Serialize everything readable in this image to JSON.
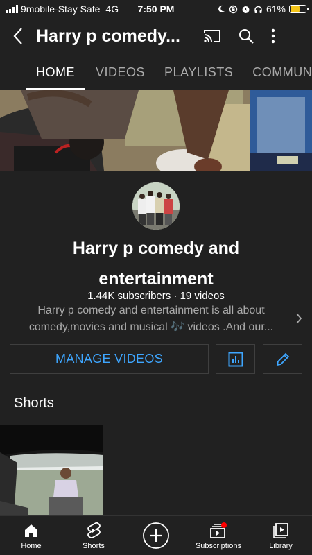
{
  "status_bar": {
    "carrier": "9mobile-Stay Safe",
    "network": "4G",
    "time": "7:50 PM",
    "battery": "61%",
    "battery_level": 0.61,
    "icons": [
      "moon-icon",
      "orientation-lock-icon",
      "alarm-icon",
      "headphones-icon"
    ]
  },
  "header": {
    "title": "Harry p comedy...",
    "icons": [
      "back-arrow-icon",
      "cast-icon",
      "search-icon",
      "more-vert-icon"
    ]
  },
  "tabs": [
    "HOME",
    "VIDEOS",
    "PLAYLISTS",
    "COMMUN"
  ],
  "channel": {
    "name": "Harry p comedy and entertainment",
    "stats": "1.44K subscribers · 19 videos",
    "description": "Harry p comedy and entertainment is all about comedy,movies and musical 🎶 videos .And our..."
  },
  "actions": {
    "manage_label": "MANAGE VIDEOS",
    "analytics_icon": "analytics-icon",
    "edit_icon": "edit-pencil-icon"
  },
  "shorts": {
    "title": "Shorts"
  },
  "bottom_nav": [
    {
      "label": "Home",
      "icon": "home-icon"
    },
    {
      "label": "Shorts",
      "icon": "shorts-icon"
    },
    {
      "label": "",
      "icon": "create-plus-icon"
    },
    {
      "label": "Subscriptions",
      "icon": "subscriptions-icon"
    },
    {
      "label": "Library",
      "icon": "library-icon"
    }
  ],
  "colors": {
    "background": "#212121",
    "accent_blue": "#3ea6ff",
    "notification_red": "#ff0000",
    "battery_yellow": "#f5c518"
  }
}
